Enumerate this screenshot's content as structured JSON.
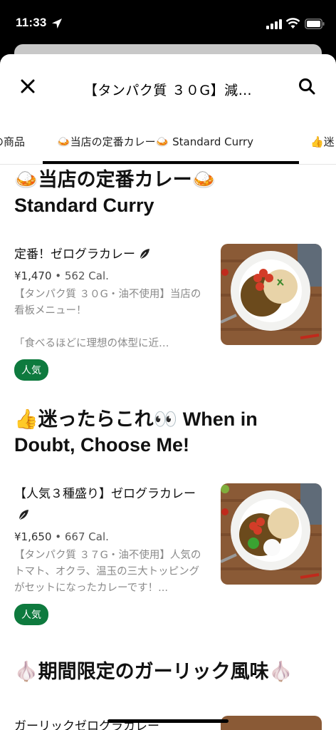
{
  "status": {
    "time": "11:33"
  },
  "header": {
    "title": "【タンパク質 ３０G】減…"
  },
  "tabs": [
    {
      "label": "の商品"
    },
    {
      "label": "🍛当店の定番カレー🍛 Standard Curry"
    },
    {
      "label": "👍迷"
    }
  ],
  "sections": [
    {
      "title_line1": "🍛当店の定番カレー🍛",
      "title_line2": "Standard Curry",
      "items": [
        {
          "name": "定番！ゼログラカレー",
          "price": "¥1,470",
          "sep": " • ",
          "calories": "562 Cal.",
          "desc": "【タンパク質 ３０G・油不使用】当店の看板メニュー！\n\n「食べるほどに理想の体型に近…",
          "badge": "人気"
        }
      ]
    },
    {
      "title_line1": "👍迷ったらこれ👀 When in",
      "title_line2": "Doubt, Choose Me!",
      "items": [
        {
          "name": "【人気３種盛り】ゼログラカレー",
          "price": "¥1,650",
          "sep": " • ",
          "calories": "667 Cal.",
          "desc": "【タンパク質 ３７G・油不使用】人気のトマト、オクラ、温玉の三大トッピングがセットになったカレーです！...",
          "badge": "人気"
        }
      ]
    },
    {
      "title_line1": "🧄期間限定のガーリック風味🧄",
      "items": [
        {
          "name": "ガーリックゼログラカレー"
        }
      ]
    }
  ],
  "colors": {
    "badge": "#0e7a3e",
    "accent": "#000000"
  },
  "icons": [
    "location-arrow-icon",
    "signal-icon",
    "wifi-icon",
    "battery-icon",
    "close-icon",
    "search-icon",
    "leaf-icon"
  ]
}
